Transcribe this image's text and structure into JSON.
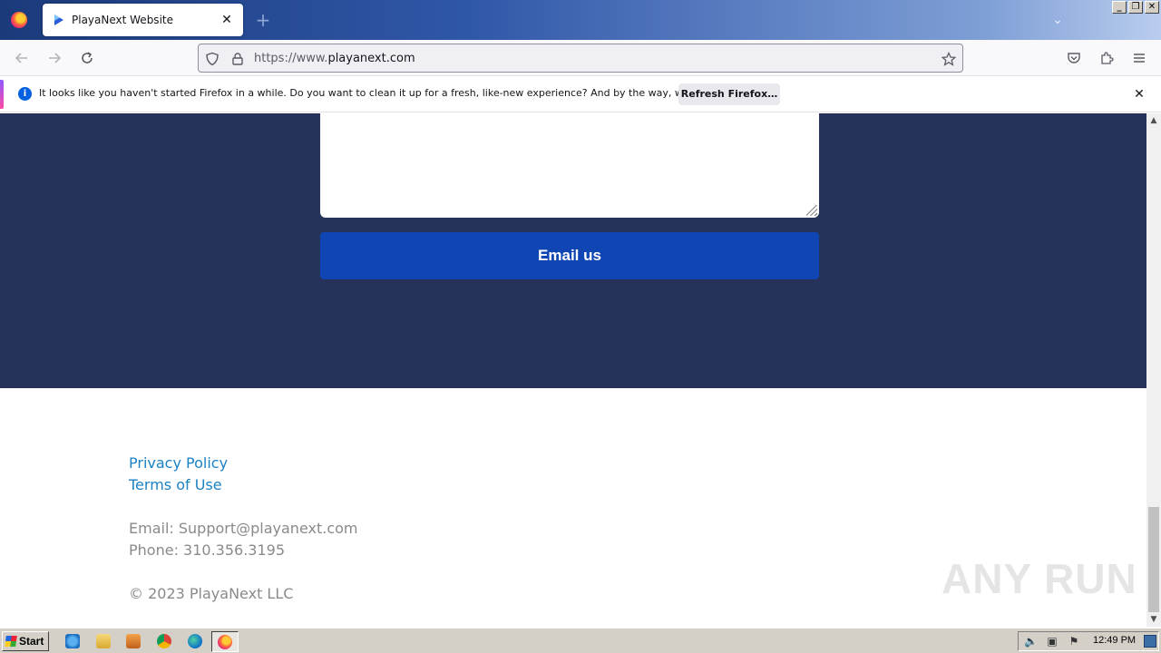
{
  "browser": {
    "tab_title": "PlayaNext Website",
    "url_prefix": "https://www.",
    "url_host": "playanext.com",
    "notification": {
      "text": "It looks like you haven't started Firefox in a while. Do you want to clean it up for a fresh, like-new experience? And by the way, welcome back!",
      "button_label": "Refresh Firefox…"
    }
  },
  "page": {
    "email_button_label": "Email us",
    "footer": {
      "privacy_policy": "Privacy Policy",
      "terms_of_use": "Terms of Use",
      "email": "Email: Support@playanext.com",
      "phone": "Phone: 310.356.3195",
      "copyright": "© 2023 PlayaNext LLC"
    },
    "watermark": "ANY RUN"
  },
  "taskbar": {
    "start_label": "Start",
    "clock": "12:49 PM"
  },
  "colors": {
    "dark_section": "#263259",
    "email_button": "#0f46b4",
    "footer_link": "#1b82c4",
    "footer_text": "#8a8a8a"
  }
}
